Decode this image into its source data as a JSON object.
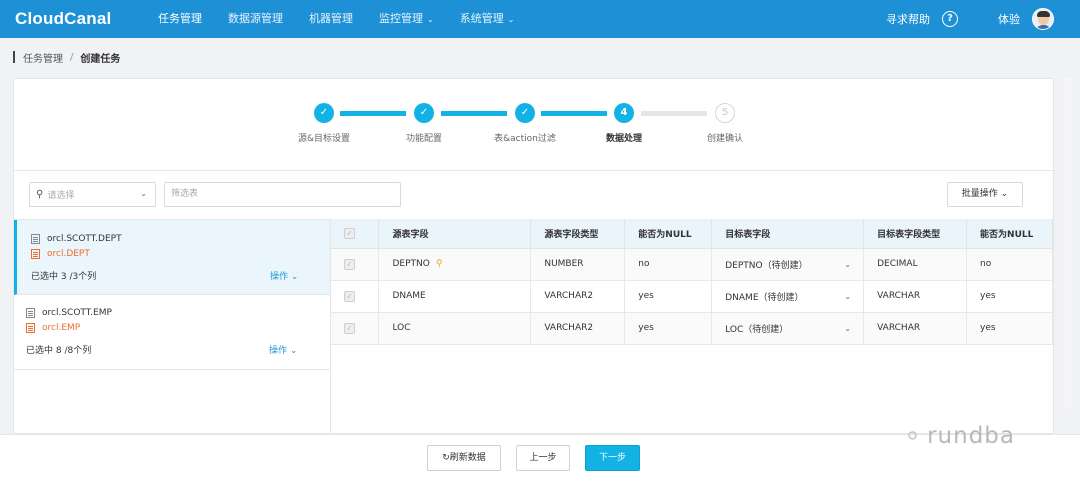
{
  "app": {
    "logo": "CloudCanal"
  },
  "nav": [
    {
      "label": "任务管理",
      "dropdown": false,
      "active": true
    },
    {
      "label": "数据源管理",
      "dropdown": false,
      "active": false
    },
    {
      "label": "机器管理",
      "dropdown": false,
      "active": false
    },
    {
      "label": "监控管理",
      "dropdown": true,
      "active": false
    },
    {
      "label": "系统管理",
      "dropdown": true,
      "active": false
    }
  ],
  "header_right": {
    "help_label": "寻求帮助",
    "help_icon": "?",
    "user_name": "体验"
  },
  "breadcrumb": {
    "parent": "任务管理",
    "separator": "/",
    "current": "创建任务"
  },
  "steps": [
    {
      "index": "1",
      "label": "源&目标设置",
      "status": "done"
    },
    {
      "index": "2",
      "label": "功能配置",
      "status": "done"
    },
    {
      "index": "3",
      "label": "表&action过滤",
      "status": "done"
    },
    {
      "index": "4",
      "label": "数据处理",
      "status": "active"
    },
    {
      "index": "5",
      "label": "创建确认",
      "status": "todo"
    }
  ],
  "filters": {
    "select_placeholder": "请选择",
    "table_placeholder": "筛选表",
    "batch_label": "批量操作"
  },
  "tables": [
    {
      "source": "orcl.SCOTT.DEPT",
      "target": "orcl.DEPT",
      "selected": "已选中 3 /3个列",
      "op": "操作",
      "active": true
    },
    {
      "source": "orcl.SCOTT.EMP",
      "target": "orcl.EMP",
      "selected": "已选中 8 /8个列",
      "op": "操作",
      "active": false
    }
  ],
  "columns": {
    "headers": [
      "源表字段",
      "源表字段类型",
      "能否为NULL",
      "目标表字段",
      "目标表字段类型",
      "能否为NULL"
    ],
    "rows": [
      {
        "src": "DEPTNO",
        "src_type": "NUMBER",
        "src_null": "no",
        "dst": "DEPTNO（待创建）",
        "dst_type": "DECIMAL",
        "dst_null": "no",
        "key": true
      },
      {
        "src": "DNAME",
        "src_type": "VARCHAR2",
        "src_null": "yes",
        "dst": "DNAME（待创建）",
        "dst_type": "VARCHAR",
        "dst_null": "yes",
        "key": false
      },
      {
        "src": "LOC",
        "src_type": "VARCHAR2",
        "src_null": "yes",
        "dst": "LOC（待创建）",
        "dst_type": "VARCHAR",
        "dst_null": "yes",
        "key": false
      }
    ]
  },
  "footer": {
    "refresh_label": "刷新数据",
    "prev_label": "上一步",
    "next_label": "下一步"
  },
  "watermark": "rundba",
  "colors": {
    "header": "#1e90d6",
    "accent": "#13b2e4",
    "target_text": "#f26b2c",
    "link": "#1a9bd8"
  }
}
